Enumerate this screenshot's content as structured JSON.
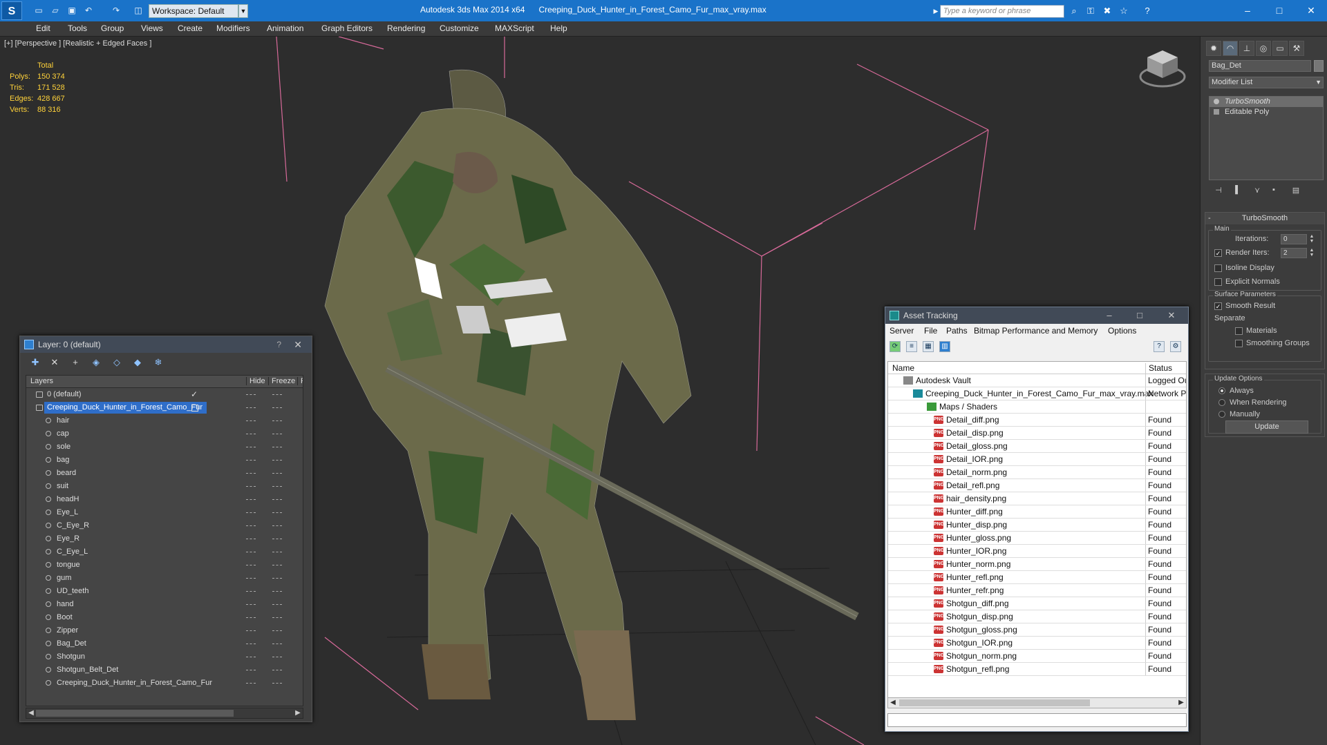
{
  "titlebar": {
    "app_title": "Autodesk 3ds Max  2014 x64",
    "file_name": "Creeping_Duck_Hunter_in_Forest_Camo_Fur_max_vray.max",
    "workspace": "Workspace: Default",
    "search_placeholder": "Type a keyword or phrase"
  },
  "menubar": [
    "Edit",
    "Tools",
    "Group",
    "Views",
    "Create",
    "Modifiers",
    "Animation",
    "Graph Editors",
    "Rendering",
    "Customize",
    "MAXScript",
    "Help"
  ],
  "viewport": {
    "label": "[+] [Perspective ] [Realistic + Edged Faces ]",
    "stats_header": "Total",
    "stats": [
      {
        "key": "Polys:",
        "value": "150 374"
      },
      {
        "key": "Tris:",
        "value": "171 528"
      },
      {
        "key": "Edges:",
        "value": "428 667"
      },
      {
        "key": "Verts:",
        "value": "88 316"
      }
    ]
  },
  "command_panel": {
    "object_name": "Bag_Det",
    "modifier_list": "Modifier List",
    "stack": [
      "TurboSmooth",
      "Editable Poly"
    ],
    "rollout_title": "TurboSmooth",
    "main_label": "Main",
    "iterations_label": "Iterations:",
    "iterations_value": "0",
    "render_iters_label": "Render Iters:",
    "render_iters_value": "2",
    "render_iters_checked": true,
    "isoline_label": "Isoline Display",
    "explicit_label": "Explicit Normals",
    "surface_label": "Surface Parameters",
    "smooth_result_label": "Smooth Result",
    "smooth_result_checked": true,
    "separate_label": "Separate",
    "materials_label": "Materials",
    "smoothing_groups_label": "Smoothing Groups",
    "update_options_label": "Update Options",
    "update_radio": [
      "Always",
      "When Rendering",
      "Manually"
    ],
    "update_selected": "Always",
    "update_button": "Update"
  },
  "layer_window": {
    "title": "Layer: 0 (default)",
    "help": "?",
    "columns": {
      "layers": "Layers",
      "hide": "Hide",
      "freeze": "Freeze",
      "render": "R"
    },
    "rows": [
      {
        "name": "0 (default)",
        "level": 0,
        "type": "layer",
        "current": true
      },
      {
        "name": "Creeping_Duck_Hunter_in_Forest_Camo_Fur",
        "level": 0,
        "type": "layer",
        "selected": true
      },
      {
        "name": "hair",
        "level": 1,
        "type": "object"
      },
      {
        "name": "cap",
        "level": 1,
        "type": "object"
      },
      {
        "name": "sole",
        "level": 1,
        "type": "object"
      },
      {
        "name": "bag",
        "level": 1,
        "type": "object"
      },
      {
        "name": "beard",
        "level": 1,
        "type": "object"
      },
      {
        "name": "suit",
        "level": 1,
        "type": "object"
      },
      {
        "name": "headH",
        "level": 1,
        "type": "object"
      },
      {
        "name": "Eye_L",
        "level": 1,
        "type": "object"
      },
      {
        "name": "C_Eye_R",
        "level": 1,
        "type": "object"
      },
      {
        "name": "Eye_R",
        "level": 1,
        "type": "object"
      },
      {
        "name": "C_Eye_L",
        "level": 1,
        "type": "object"
      },
      {
        "name": "tongue",
        "level": 1,
        "type": "object"
      },
      {
        "name": "gum",
        "level": 1,
        "type": "object"
      },
      {
        "name": "UD_teeth",
        "level": 1,
        "type": "object"
      },
      {
        "name": "hand",
        "level": 1,
        "type": "object"
      },
      {
        "name": "Boot",
        "level": 1,
        "type": "object"
      },
      {
        "name": "Zipper",
        "level": 1,
        "type": "object"
      },
      {
        "name": "Bag_Det",
        "level": 1,
        "type": "object"
      },
      {
        "name": "Shotgun",
        "level": 1,
        "type": "object"
      },
      {
        "name": "Shotgun_Belt_Det",
        "level": 1,
        "type": "object"
      },
      {
        "name": "Creeping_Duck_Hunter_in_Forest_Camo_Fur",
        "level": 1,
        "type": "object"
      }
    ]
  },
  "asset_window": {
    "title": "Asset Tracking",
    "menu": [
      "Server",
      "File",
      "Paths",
      "Bitmap Performance and Memory",
      "Options"
    ],
    "columns": {
      "name": "Name",
      "status": "Status"
    },
    "rows": [
      {
        "name": "Autodesk Vault",
        "status": "Logged Out",
        "icon": "vault",
        "level": 0
      },
      {
        "name": "Creeping_Duck_Hunter_in_Forest_Camo_Fur_max_vray.max",
        "status": "Network Path",
        "icon": "max",
        "level": 1
      },
      {
        "name": "Maps / Shaders",
        "status": "",
        "icon": "maps",
        "level": 2
      },
      {
        "name": "Detail_diff.png",
        "status": "Found",
        "icon": "png",
        "level": 3
      },
      {
        "name": "Detail_disp.png",
        "status": "Found",
        "icon": "png",
        "level": 3
      },
      {
        "name": "Detail_gloss.png",
        "status": "Found",
        "icon": "png",
        "level": 3
      },
      {
        "name": "Detail_IOR.png",
        "status": "Found",
        "icon": "png",
        "level": 3
      },
      {
        "name": "Detail_norm.png",
        "status": "Found",
        "icon": "png",
        "level": 3
      },
      {
        "name": "Detail_refl.png",
        "status": "Found",
        "icon": "png",
        "level": 3
      },
      {
        "name": "hair_density.png",
        "status": "Found",
        "icon": "png",
        "level": 3
      },
      {
        "name": "Hunter_diff.png",
        "status": "Found",
        "icon": "png",
        "level": 3
      },
      {
        "name": "Hunter_disp.png",
        "status": "Found",
        "icon": "png",
        "level": 3
      },
      {
        "name": "Hunter_gloss.png",
        "status": "Found",
        "icon": "png",
        "level": 3
      },
      {
        "name": "Hunter_IOR.png",
        "status": "Found",
        "icon": "png",
        "level": 3
      },
      {
        "name": "Hunter_norm.png",
        "status": "Found",
        "icon": "png",
        "level": 3
      },
      {
        "name": "Hunter_refl.png",
        "status": "Found",
        "icon": "png",
        "level": 3
      },
      {
        "name": "Hunter_refr.png",
        "status": "Found",
        "icon": "png",
        "level": 3
      },
      {
        "name": "Shotgun_diff.png",
        "status": "Found",
        "icon": "png",
        "level": 3
      },
      {
        "name": "Shotgun_disp.png",
        "status": "Found",
        "icon": "png",
        "level": 3
      },
      {
        "name": "Shotgun_gloss.png",
        "status": "Found",
        "icon": "png",
        "level": 3
      },
      {
        "name": "Shotgun_IOR.png",
        "status": "Found",
        "icon": "png",
        "level": 3
      },
      {
        "name": "Shotgun_norm.png",
        "status": "Found",
        "icon": "png",
        "level": 3
      },
      {
        "name": "Shotgun_refl.png",
        "status": "Found",
        "icon": "png",
        "level": 3
      }
    ]
  }
}
